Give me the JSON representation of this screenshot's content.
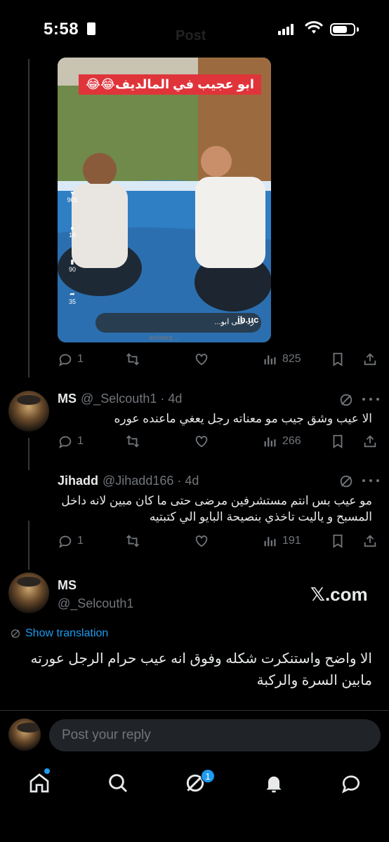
{
  "status_bar": {
    "time": "5:58",
    "title": "Post"
  },
  "media": {
    "caption": "ابو عجيب في المالديف😂😂",
    "side_counts": [
      "905",
      "14",
      "90",
      "35"
    ],
    "reply_prompt": "رد على ابو...",
    "watermark": "ib.uc",
    "footer": "eurlaerg ... ",
    "accent": "#e0343b"
  },
  "tweets": [
    {
      "replies": "1",
      "views": "825"
    },
    {
      "name": "MS",
      "handle": "@_Selcouth1",
      "time": "4d",
      "text": "الا عيب وشق جيب مو معناته رجل يعغي ماعنده عوره",
      "replies": "1",
      "views": "266"
    },
    {
      "name": "Jihadd",
      "handle": "@Jihadd166",
      "time": "4d",
      "text": "مو عيب بس انتم مستشرفين مرضى حتى ما كان مبين لانه داخل المسبح و ياليت تاخذي بنصيحة البايو الي كتبتيه",
      "replies": "1",
      "views": "191"
    }
  ],
  "main_tweet": {
    "name": "MS",
    "handle": "@_Selcouth1",
    "watermark": "𝕏.com",
    "translate_label": "Show translation",
    "text": "الا واضح واستنكرت شكله وفوق انه عيب حرام الرجل عورته مابين السرة والركبة"
  },
  "reply_bar": {
    "placeholder": "Post your reply"
  },
  "nav": {
    "messages_badge": "1",
    "accent": "#1d9bf0"
  },
  "icons": [
    "reply-icon",
    "retweet-icon",
    "like-icon",
    "views-icon",
    "bookmark-icon",
    "share-icon",
    "grok-icon",
    "more-icon",
    "home-icon",
    "search-icon",
    "grok-nav-icon",
    "notifications-icon",
    "messages-icon"
  ]
}
